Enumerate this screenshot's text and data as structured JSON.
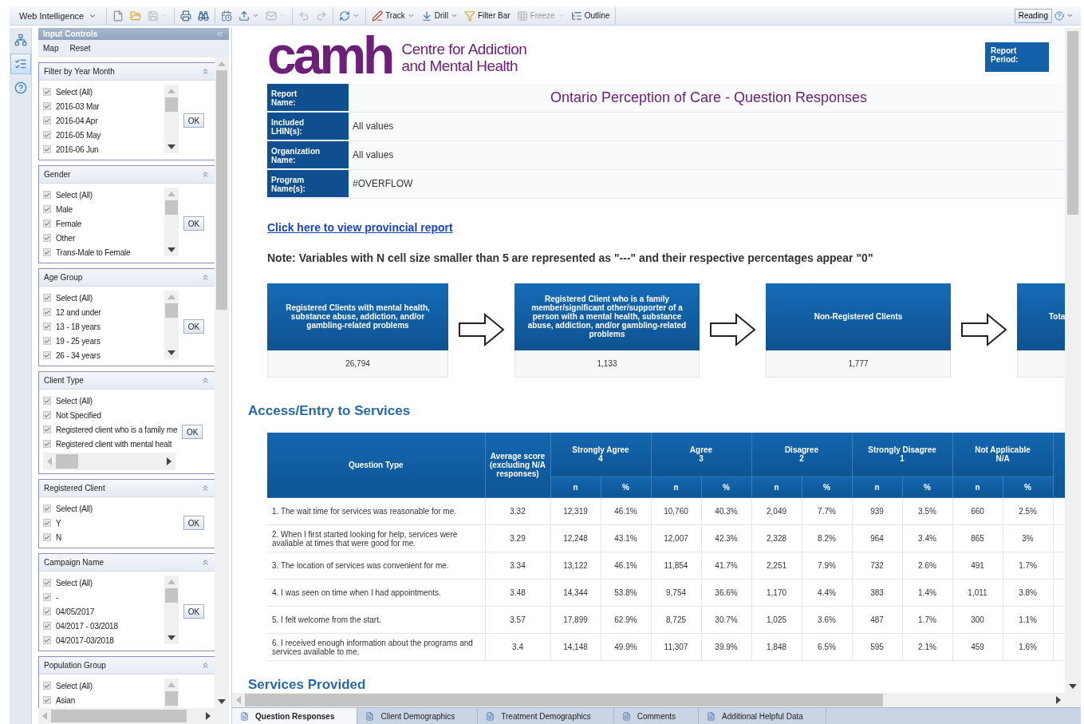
{
  "toolbar": {
    "app_menu": "Web Intelligence",
    "groups": [
      [
        {
          "kind": "document",
          "dropdown": false,
          "disabled": false
        },
        {
          "kind": "folder",
          "dropdown": false,
          "disabled": false
        },
        {
          "kind": "save",
          "dropdown": true,
          "disabled": true
        }
      ],
      [
        {
          "kind": "print",
          "dropdown": false,
          "disabled": false
        },
        {
          "kind": "find",
          "dropdown": false,
          "disabled": false
        }
      ],
      [
        {
          "kind": "schedule",
          "dropdown": false,
          "disabled": false
        },
        {
          "kind": "export",
          "dropdown": true,
          "disabled": false
        },
        {
          "kind": "mail",
          "dropdown": true,
          "disabled": true
        }
      ],
      [
        {
          "kind": "undo",
          "dropdown": false,
          "disabled": true
        },
        {
          "kind": "redo",
          "dropdown": false,
          "disabled": true
        }
      ],
      [
        {
          "kind": "refresh",
          "dropdown": true,
          "disabled": false
        }
      ],
      [
        {
          "kind": "track",
          "label": "Track",
          "dropdown": true,
          "disabled": false
        },
        {
          "kind": "drill",
          "label": "Drill",
          "dropdown": true,
          "disabled": false
        },
        {
          "kind": "filter",
          "label": "Filter Bar",
          "dropdown": false,
          "disabled": false
        },
        {
          "kind": "freeze",
          "label": "Freeze",
          "dropdown": true,
          "disabled": true
        },
        {
          "kind": "outline",
          "label": "Outline",
          "dropdown": false,
          "disabled": false
        }
      ]
    ],
    "reading": "Reading"
  },
  "side_tabs": [
    {
      "kind": "tree",
      "selected": false
    },
    {
      "kind": "controls",
      "selected": true
    },
    {
      "kind": "help",
      "selected": false
    }
  ],
  "input_controls": {
    "title": "Input Controls",
    "actions": [
      "Map",
      "Reset"
    ],
    "groups": [
      {
        "title": "Filter by Year Month",
        "kind": "vertical",
        "button": "OK",
        "items": [
          {
            "label": "Select (All)",
            "checked": true
          },
          {
            "label": "2016-03 Mar",
            "checked": true
          },
          {
            "label": "2016-04 Apr",
            "checked": true
          },
          {
            "label": "2016-05 May",
            "checked": true
          },
          {
            "label": "2016-06 Jun",
            "checked": true
          }
        ]
      },
      {
        "title": "Gender",
        "kind": "vertical",
        "button": "OK",
        "items": [
          {
            "label": "Select (All)",
            "checked": true
          },
          {
            "label": "Male",
            "checked": true
          },
          {
            "label": "Female",
            "checked": true
          },
          {
            "label": "Other",
            "checked": true
          },
          {
            "label": "Trans-Male to Female",
            "checked": true
          }
        ]
      },
      {
        "title": "Age Group",
        "kind": "vertical",
        "button": "OK",
        "items": [
          {
            "label": "Select (All)",
            "checked": true
          },
          {
            "label": "12 and under",
            "checked": true
          },
          {
            "label": "13 - 18 years",
            "checked": true
          },
          {
            "label": "19 - 25 years",
            "checked": true
          },
          {
            "label": "26 - 34 years",
            "checked": true
          }
        ]
      },
      {
        "title": "Client Type",
        "kind": "horizontal",
        "button": "OK",
        "items": [
          {
            "label": "Select (All)",
            "checked": true
          },
          {
            "label": "Not Specified",
            "checked": true
          },
          {
            "label": "Registered client who is a family me",
            "checked": true
          },
          {
            "label": "Registered client with mental healt",
            "checked": true
          }
        ]
      },
      {
        "title": "Registered Client",
        "kind": "plain",
        "button": "OK",
        "items": [
          {
            "label": "Select (All)",
            "checked": true
          },
          {
            "label": "Y",
            "checked": true
          },
          {
            "label": "N",
            "checked": true
          }
        ]
      },
      {
        "title": "Campaign Name",
        "kind": "vertical",
        "button": "OK",
        "items": [
          {
            "label": "Select (All)",
            "checked": true
          },
          {
            "label": "-",
            "checked": true
          },
          {
            "label": "04/05/2017",
            "checked": true
          },
          {
            "label": "04/2017 - 03/2018",
            "checked": true
          },
          {
            "label": "04/2017-03/2018",
            "checked": true
          }
        ]
      },
      {
        "title": "Population Group",
        "kind": "vertical",
        "items": [
          {
            "label": "Select (All)",
            "checked": true
          },
          {
            "label": "Asian",
            "checked": true
          }
        ]
      }
    ]
  },
  "report": {
    "logo": {
      "wordmark": "camh",
      "line_1": "Centre for Addiction",
      "line_2": "and Mental Health"
    },
    "report_period_label": "Report\nPeriod:",
    "info_rows": [
      {
        "kind": "title",
        "label": "Report\nName:",
        "value": "Ontario Perception of Care - Question Responses"
      },
      {
        "kind": "plain",
        "label": "Included\nLHIN(s):",
        "value": "All values"
      },
      {
        "kind": "plain",
        "label": "Organization\nName:",
        "value": "All values"
      },
      {
        "kind": "plain",
        "label": "Program\nName(s):",
        "value": "#OVERFLOW"
      }
    ],
    "link": "Click here to view provincial report",
    "note": "Note: Variables with N cell size smaller than 5 are represented as \"---\" and their respective percentages appear \"0\"",
    "flow": [
      {
        "title": "Registered Clients with mental health, substance abuse, addiction, and/or gambling-related problems",
        "value": "26,794"
      },
      {
        "title": "Registered Client who is a family member/significant other/supporter of a person with a mental health, substance abuse, addiction, and/or gambling-related problems",
        "value": "1,133"
      },
      {
        "title": "Non-Registered Clients",
        "value": "1,777"
      },
      {
        "title": "Tota"
      }
    ],
    "section_1": "Access/Entry to Services",
    "table": {
      "question_header": "Question Type",
      "average_header": "Average score (excluding N/A responses)",
      "groups": [
        {
          "label": "Strongly Agree",
          "score": "4",
          "n": "n",
          "pct": "%"
        },
        {
          "label": "Agree",
          "score": "3",
          "n": "n",
          "pct": "%"
        },
        {
          "label": "Disagree",
          "score": "2",
          "n": "n",
          "pct": "%"
        },
        {
          "label": "Strongly Disagree",
          "score": "1",
          "n": "n",
          "pct": "%"
        },
        {
          "label": "Not Applicable",
          "score": "N/A",
          "n": "n",
          "pct": "%"
        }
      ],
      "rows": [
        {
          "question": "1. The wait time for services was reasonable for me.",
          "average": "3.32",
          "cells": [
            "12,319",
            "46.1%",
            "10,760",
            "40.3%",
            "2,049",
            "7.7%",
            "939",
            "3.5%",
            "660",
            "2.5%"
          ]
        },
        {
          "question": "2. When I first started looking for help, services were avaliable at times that were good for me.",
          "average": "3.29",
          "cells": [
            "12,248",
            "43.1%",
            "12,007",
            "42.3%",
            "2,328",
            "8.2%",
            "964",
            "3.4%",
            "865",
            "3%"
          ]
        },
        {
          "question": "3. The location of services was convenient for me.",
          "average": "3.34",
          "cells": [
            "13,122",
            "46.1%",
            "11,854",
            "41.7%",
            "2,251",
            "7.9%",
            "732",
            "2.6%",
            "491",
            "1.7%"
          ]
        },
        {
          "question": "4. I was seen on time when I had appointments.",
          "average": "3.48",
          "cells": [
            "14,344",
            "53.8%",
            "9,754",
            "36.6%",
            "1,170",
            "4.4%",
            "383",
            "1.4%",
            "1,011",
            "3.8%"
          ]
        },
        {
          "question": "5. I felt welcome from the start.",
          "average": "3.57",
          "cells": [
            "17,899",
            "62.9%",
            "8,725",
            "30.7%",
            "1,025",
            "3.6%",
            "487",
            "1.7%",
            "300",
            "1.1%"
          ]
        },
        {
          "question": "6. I received enough information about the programs and services available to me.",
          "average": "3.4",
          "cells": [
            "14,148",
            "49.9%",
            "11,307",
            "39.9%",
            "1,848",
            "6.5%",
            "595",
            "2.1%",
            "459",
            "1.6%"
          ]
        }
      ]
    },
    "section_2": "Services Provided"
  },
  "tabs": [
    {
      "label": "Question Responses",
      "selected": true
    },
    {
      "label": "Client Demographics",
      "selected": false
    },
    {
      "label": "Treatment Demographics",
      "selected": false
    },
    {
      "label": "Comments",
      "selected": false
    },
    {
      "label": "Additional Helpful Data",
      "selected": false
    }
  ]
}
